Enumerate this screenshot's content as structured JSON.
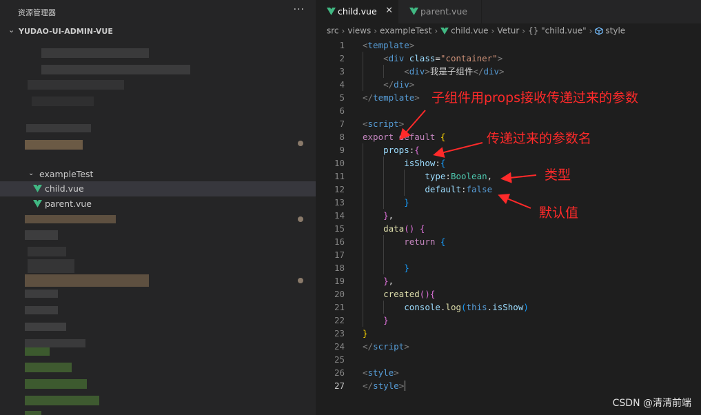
{
  "sidebar": {
    "title": "资源管理器",
    "more": "···",
    "project": "YUDAO-UI-ADMIN-VUE",
    "folder": "exampleTest",
    "files": [
      {
        "label": "child.vue",
        "active": true
      },
      {
        "label": "parent.vue",
        "active": false
      }
    ]
  },
  "tabs": [
    {
      "label": "child.vue",
      "active": true,
      "close": "✕"
    },
    {
      "label": "parent.vue",
      "active": false
    }
  ],
  "breadcrumb": {
    "items": [
      "src",
      "views",
      "exampleTest",
      "child.vue",
      "Vetur",
      "{} \"child.vue\"",
      "style"
    ],
    "sep": "›"
  },
  "code": {
    "current_line": 27,
    "lines": [
      [
        [
          "t-punc",
          "<"
        ],
        [
          "t-tag",
          "template"
        ],
        [
          "t-punc",
          ">"
        ]
      ],
      [
        [
          "t-text",
          "    "
        ],
        [
          "t-punc",
          "<"
        ],
        [
          "t-tag",
          "div"
        ],
        [
          "t-text",
          " "
        ],
        [
          "t-attr",
          "class"
        ],
        [
          "t-text",
          "="
        ],
        [
          "t-str",
          "\"container\""
        ],
        [
          "t-punc",
          ">"
        ]
      ],
      [
        [
          "t-text",
          "        "
        ],
        [
          "t-punc",
          "<"
        ],
        [
          "t-tag",
          "div"
        ],
        [
          "t-punc",
          ">"
        ],
        [
          "t-text",
          "我是子组件"
        ],
        [
          "t-punc",
          "</"
        ],
        [
          "t-tag",
          "div"
        ],
        [
          "t-punc",
          ">"
        ]
      ],
      [
        [
          "t-text",
          "    "
        ],
        [
          "t-punc",
          "</"
        ],
        [
          "t-tag",
          "div"
        ],
        [
          "t-punc",
          ">"
        ]
      ],
      [
        [
          "t-punc",
          "</"
        ],
        [
          "t-tag",
          "template"
        ],
        [
          "t-punc",
          ">"
        ]
      ],
      [],
      [
        [
          "t-punc",
          "<"
        ],
        [
          "t-tag",
          "script"
        ],
        [
          "t-punc",
          ">"
        ]
      ],
      [
        [
          "t-kw",
          "export"
        ],
        [
          "t-text",
          " "
        ],
        [
          "t-kw",
          "default"
        ],
        [
          "t-text",
          " "
        ],
        [
          "t-b1",
          "{"
        ]
      ],
      [
        [
          "t-text",
          "    "
        ],
        [
          "t-attr",
          "props"
        ],
        [
          "t-text",
          ":"
        ],
        [
          "t-b2",
          "{"
        ]
      ],
      [
        [
          "t-text",
          "        "
        ],
        [
          "t-attr",
          "isShow"
        ],
        [
          "t-text",
          ":"
        ],
        [
          "t-b3",
          "{"
        ]
      ],
      [
        [
          "t-text",
          "            "
        ],
        [
          "t-attr",
          "type"
        ],
        [
          "t-text",
          ":"
        ],
        [
          "t-type",
          "Boolean"
        ],
        [
          "t-text",
          ","
        ]
      ],
      [
        [
          "t-text",
          "            "
        ],
        [
          "t-attr",
          "default"
        ],
        [
          "t-text",
          ":"
        ],
        [
          "t-bool",
          "false"
        ]
      ],
      [
        [
          "t-text",
          "        "
        ],
        [
          "t-b3",
          "}"
        ]
      ],
      [
        [
          "t-text",
          "    "
        ],
        [
          "t-b2",
          "}"
        ],
        [
          "t-text",
          ","
        ]
      ],
      [
        [
          "t-text",
          "    "
        ],
        [
          "t-func",
          "data"
        ],
        [
          "t-b2",
          "()"
        ],
        [
          "t-text",
          " "
        ],
        [
          "t-b2",
          "{"
        ]
      ],
      [
        [
          "t-text",
          "        "
        ],
        [
          "t-kw",
          "return"
        ],
        [
          "t-text",
          " "
        ],
        [
          "t-b3",
          "{"
        ]
      ],
      [],
      [
        [
          "t-text",
          "        "
        ],
        [
          "t-b3",
          "}"
        ]
      ],
      [
        [
          "t-text",
          "    "
        ],
        [
          "t-b2",
          "}"
        ],
        [
          "t-text",
          ","
        ]
      ],
      [
        [
          "t-text",
          "    "
        ],
        [
          "t-func",
          "created"
        ],
        [
          "t-b2",
          "(){"
        ]
      ],
      [
        [
          "t-text",
          "        "
        ],
        [
          "t-attr",
          "console"
        ],
        [
          "t-text",
          "."
        ],
        [
          "t-func",
          "log"
        ],
        [
          "t-b3",
          "("
        ],
        [
          "t-tag",
          "this"
        ],
        [
          "t-text",
          "."
        ],
        [
          "t-attr",
          "isShow"
        ],
        [
          "t-b3",
          ")"
        ]
      ],
      [
        [
          "t-text",
          "    "
        ],
        [
          "t-b2",
          "}"
        ]
      ],
      [
        [
          "t-b1",
          "}"
        ]
      ],
      [
        [
          "t-punc",
          "</"
        ],
        [
          "t-tag",
          "script"
        ],
        [
          "t-punc",
          ">"
        ]
      ],
      [],
      [
        [
          "t-punc",
          "<"
        ],
        [
          "t-tag",
          "style"
        ],
        [
          "t-punc",
          ">"
        ]
      ],
      [
        [
          "t-punc",
          "</"
        ],
        [
          "t-tag",
          "style"
        ],
        [
          "t-punc",
          ">"
        ]
      ]
    ]
  },
  "annotations": {
    "props_receive": "子组件用props接收传递过来的参数",
    "param_name": "传递过来的参数名",
    "type": "类型",
    "default_value": "默认值"
  },
  "watermark": "CSDN @清清前端",
  "colors": {
    "vue_green": "#41b883",
    "annotation_red": "#ff2a2a"
  }
}
